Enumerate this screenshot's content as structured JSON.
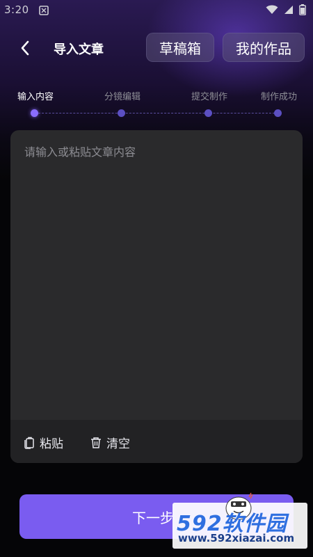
{
  "status_bar": {
    "time": "3:20"
  },
  "header": {
    "title": "导入文章",
    "drafts_label": "草稿箱",
    "works_label": "我的作品"
  },
  "stepper": {
    "steps": [
      {
        "label": "输入内容",
        "active": true
      },
      {
        "label": "分镜编辑",
        "active": false
      },
      {
        "label": "提交制作",
        "active": false
      },
      {
        "label": "制作成功",
        "active": false
      }
    ],
    "accent_color": "#8a6dff"
  },
  "editor": {
    "placeholder": "请输入或粘贴文章内容",
    "value": "",
    "paste_label": "粘贴",
    "clear_label": "清空"
  },
  "footer": {
    "next_label": "下一步"
  },
  "watermark": {
    "brand_number": "592",
    "brand_text": "软件园",
    "url": "www.592xiazai.com"
  },
  "colors": {
    "primary": "#7a5cf0",
    "card_bg": "#2a2a2c",
    "header_gradient_top": "#2a1a52"
  }
}
